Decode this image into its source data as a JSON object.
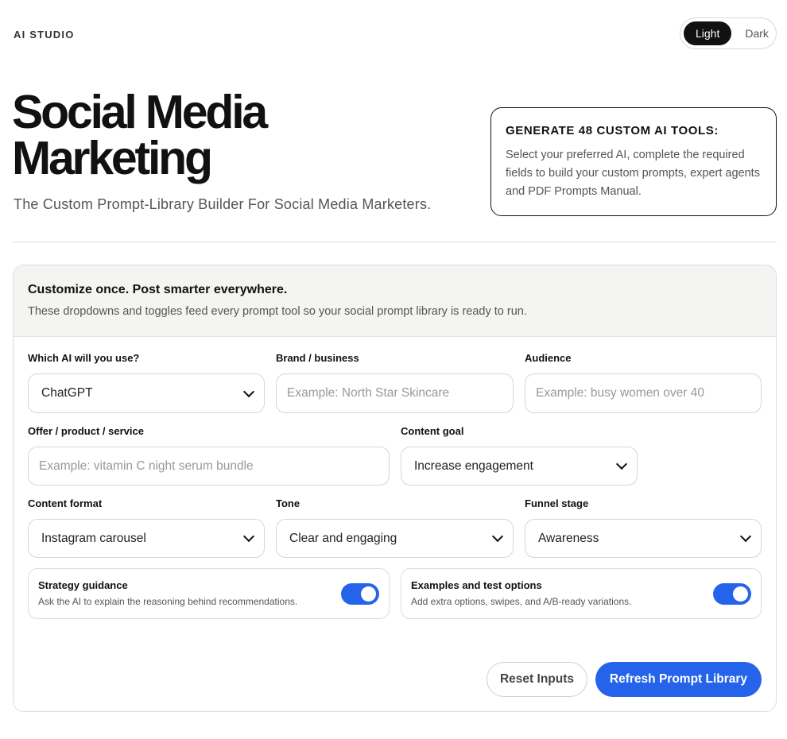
{
  "header": {
    "brand": "AI STUDIO",
    "theme": {
      "light_label": "Light",
      "dark_label": "Dark",
      "selected": "Light"
    }
  },
  "hero": {
    "title_line1": "Social Media",
    "title_line2": "Marketing",
    "subtitle": "The Custom Prompt-Library Builder For Social Media Marketers."
  },
  "promo": {
    "title": "GENERATE 48 CUSTOM AI TOOLS:",
    "text": "Select your preferred AI, complete the required fields to build your custom prompts, expert agents and PDF Prompts Manual."
  },
  "panel": {
    "title": "Customize once. Post smarter everywhere.",
    "description": "These dropdowns and toggles feed every prompt tool so your social prompt library is ready to run."
  },
  "form": {
    "ai": {
      "label": "Which AI will you use?",
      "value": "ChatGPT"
    },
    "brand": {
      "label": "Brand / business",
      "value": "",
      "placeholder": "Example: North Star Skincare"
    },
    "audience": {
      "label": "Audience",
      "value": "",
      "placeholder": "Example: busy women over 40"
    },
    "offer": {
      "label": "Offer / product / service",
      "value": "",
      "placeholder": "Example: vitamin C night serum bundle"
    },
    "goal": {
      "label": "Content goal",
      "value": "Increase engagement"
    },
    "format": {
      "label": "Content format",
      "value": "Instagram carousel"
    },
    "tone": {
      "label": "Tone",
      "value": "Clear and engaging"
    },
    "funnel": {
      "label": "Funnel stage",
      "value": "Awareness"
    }
  },
  "toggles": {
    "strategy": {
      "title": "Strategy guidance",
      "description": "Ask the AI to explain the reasoning behind recommendations.",
      "on": true
    },
    "examples": {
      "title": "Examples and test options",
      "description": "Add extra options, swipes, and A/B-ready variations.",
      "on": true
    }
  },
  "actions": {
    "reset_label": "Reset Inputs",
    "refresh_label": "Refresh Prompt Library"
  },
  "colors": {
    "accent": "#2563eb",
    "panel_header_bg": "#f4f5f2",
    "text_dark": "#111111"
  }
}
